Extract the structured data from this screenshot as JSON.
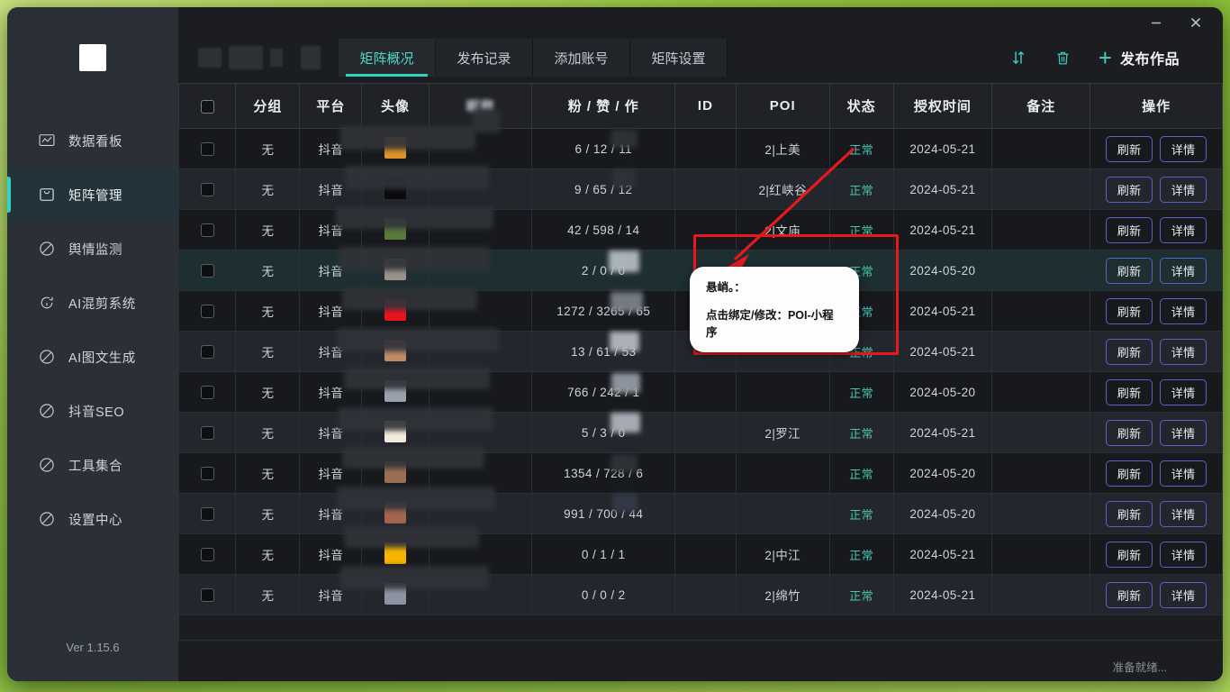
{
  "window": {
    "minimize_label": "—",
    "close_label": "✕"
  },
  "sidebar": {
    "logo_name": "app-logo",
    "version": "Ver 1.15.6",
    "items": [
      {
        "label": "数据看板",
        "icon": "chart-board-icon",
        "active": false
      },
      {
        "label": "矩阵管理",
        "icon": "matrix-box-icon",
        "active": true
      },
      {
        "label": "舆情监测",
        "icon": "forbidden-circle-icon",
        "active": false
      },
      {
        "label": "AI混剪系统",
        "icon": "refresh-circle-icon",
        "active": false
      },
      {
        "label": "AI图文生成",
        "icon": "forbidden-circle-icon",
        "active": false
      },
      {
        "label": "抖音SEO",
        "icon": "forbidden-circle-icon",
        "active": false
      },
      {
        "label": "工具集合",
        "icon": "forbidden-circle-icon",
        "active": false
      },
      {
        "label": "设置中心",
        "icon": "forbidden-circle-icon",
        "active": false
      }
    ]
  },
  "tabs": [
    {
      "label": "矩阵概况",
      "active": true
    },
    {
      "label": "发布记录",
      "active": false
    },
    {
      "label": "添加账号",
      "active": false
    },
    {
      "label": "矩阵设置",
      "active": false
    }
  ],
  "toolbar": {
    "sort_icon": "sort-updown-icon",
    "delete_icon": "trash-icon",
    "publish_plus": "+",
    "publish_label": "发布作品"
  },
  "table": {
    "columns": [
      {
        "key": "check",
        "label": "",
        "icon": "select-all-checkbox"
      },
      {
        "key": "group",
        "label": "分组"
      },
      {
        "key": "platform",
        "label": "平台"
      },
      {
        "key": "avatar",
        "label": "头像"
      },
      {
        "key": "nickname",
        "label": "昵称",
        "censored": true
      },
      {
        "key": "stats",
        "label": "粉 / 赞 / 作"
      },
      {
        "key": "id",
        "label": "ID"
      },
      {
        "key": "poi",
        "label": "POI"
      },
      {
        "key": "status",
        "label": "状态"
      },
      {
        "key": "auth_time",
        "label": "授权时间"
      },
      {
        "key": "remark",
        "label": "备注"
      },
      {
        "key": "action",
        "label": "操作"
      }
    ],
    "row_actions": {
      "refresh": "刷新",
      "detail": "详情"
    },
    "rows": [
      {
        "group": "无",
        "platform": "抖音",
        "avatar_color": "#e09227",
        "stats": "6 / 12 / 11",
        "poi": "2|上美",
        "status": "正常",
        "auth_time": "2024-05-21",
        "remark": "",
        "highlight": false
      },
      {
        "group": "无",
        "platform": "抖音",
        "avatar_color": "#0b0b0b",
        "stats": "9 / 65 / 12",
        "poi": "2|红峡谷",
        "status": "正常",
        "auth_time": "2024-05-21",
        "remark": "",
        "highlight": false
      },
      {
        "group": "无",
        "platform": "抖音",
        "avatar_color": "#5a7a3b",
        "stats": "42 / 598 / 14",
        "poi": "2|文庙",
        "status": "正常",
        "auth_time": "2024-05-21",
        "remark": "",
        "highlight": false
      },
      {
        "group": "无",
        "platform": "抖音",
        "avatar_color": "#9a938c",
        "stats": "2 / 0 / 0",
        "poi": "",
        "status": "正常",
        "auth_time": "2024-05-20",
        "remark": "",
        "highlight": true
      },
      {
        "group": "无",
        "platform": "抖音",
        "avatar_color": "#e8131d",
        "stats": "1272 / 3265 / 65",
        "poi": "",
        "status": "正常",
        "auth_time": "2024-05-21",
        "remark": "",
        "highlight": false
      },
      {
        "group": "无",
        "platform": "抖音",
        "avatar_color": "#c08b64",
        "stats": "13 / 61 / 53",
        "poi": "",
        "status": "正常",
        "auth_time": "2024-05-21",
        "remark": "",
        "highlight": false
      },
      {
        "group": "无",
        "platform": "抖音",
        "avatar_color": "#9aa0ac",
        "stats": "766 / 242 / 1",
        "poi": "",
        "status": "正常",
        "auth_time": "2024-05-20",
        "remark": "",
        "highlight": false
      },
      {
        "group": "无",
        "platform": "抖音",
        "avatar_color": "#f3eade",
        "stats": "5 / 3 / 0",
        "poi": "2|罗江",
        "status": "正常",
        "auth_time": "2024-05-21",
        "remark": "",
        "highlight": false
      },
      {
        "group": "无",
        "platform": "抖音",
        "avatar_color": "#9c6f55",
        "stats": "1354 / 728 / 6",
        "poi": "",
        "status": "正常",
        "auth_time": "2024-05-20",
        "remark": "",
        "highlight": false
      },
      {
        "group": "无",
        "platform": "抖音",
        "avatar_color": "#a5664f",
        "stats": "991 / 700 / 44",
        "poi": "",
        "status": "正常",
        "auth_time": "2024-05-20",
        "remark": "",
        "highlight": false
      },
      {
        "group": "无",
        "platform": "抖音",
        "avatar_color": "#f7b500",
        "stats": "0 / 1 / 1",
        "poi": "2|中江",
        "status": "正常",
        "auth_time": "2024-05-21",
        "remark": "",
        "highlight": false
      },
      {
        "group": "无",
        "platform": "抖音",
        "avatar_color": "#8c93a1",
        "stats": "0 / 0 / 2",
        "poi": "2|绵竹",
        "status": "正常",
        "auth_time": "2024-05-21",
        "remark": "",
        "highlight": false
      }
    ]
  },
  "annotation": {
    "tooltip_line1": "悬峭。：",
    "tooltip_line2": "点击绑定/修改：POI-小程序",
    "highlight_color": "#e8191d"
  },
  "statusbar": {
    "text": "准备就绪..."
  }
}
